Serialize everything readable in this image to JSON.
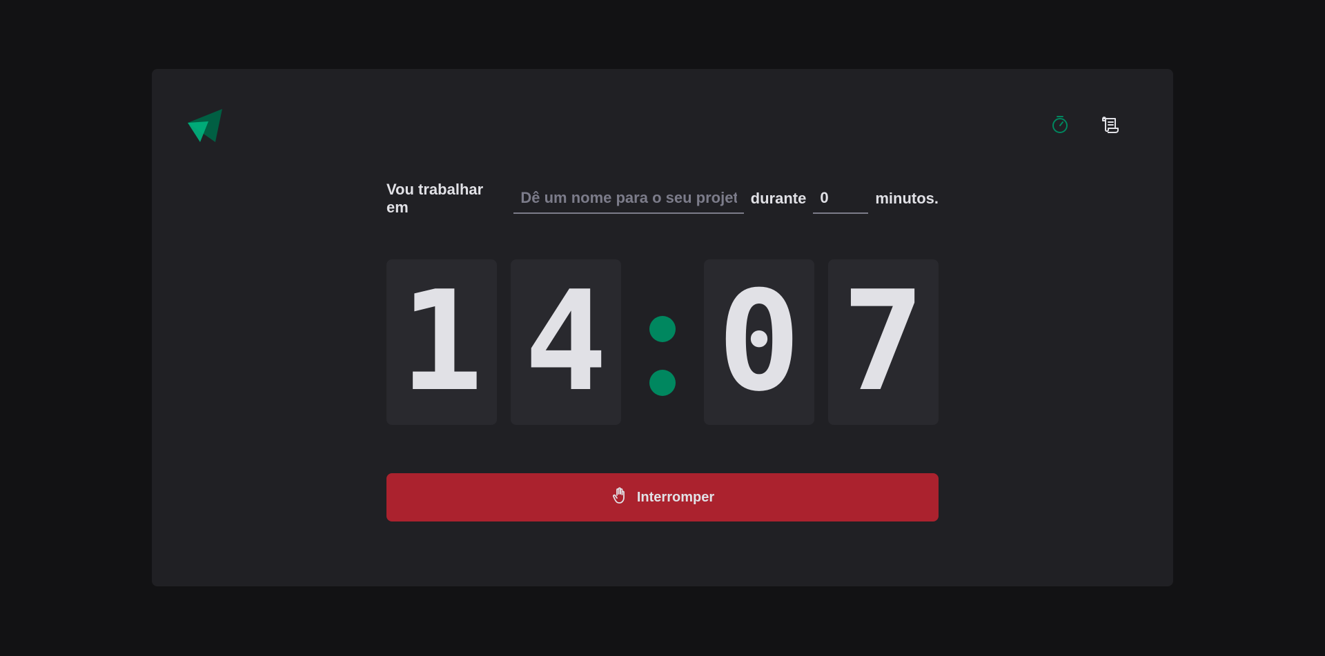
{
  "icons": {
    "logo": "paper-plane-logo",
    "timer": "timer-icon",
    "history": "scroll-icon",
    "stop": "hand-palm-icon"
  },
  "colors": {
    "background": "#121214",
    "panel": "#202024",
    "digit_bg": "#29292e",
    "accent_green": "#00875f",
    "stop_red": "#ab222e",
    "text": "#e1e1e6",
    "placeholder": "#7c7c8a"
  },
  "form": {
    "label_prefix": "Vou trabalhar em",
    "task_placeholder": "Dê um nome para o seu projeto",
    "task_value": "",
    "label_during": "durante",
    "minutes_value": "0",
    "label_suffix": "minutos."
  },
  "countdown": {
    "minutes_tens": "1",
    "minutes_ones": "4",
    "seconds_tens": "0",
    "seconds_ones": "7"
  },
  "stop_button": {
    "label": "Interromper"
  }
}
